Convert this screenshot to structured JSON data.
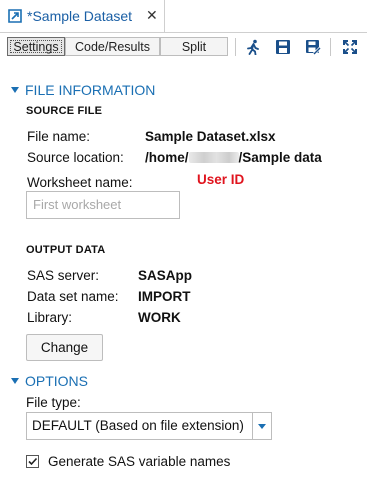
{
  "tab": {
    "title": "*Sample Dataset",
    "close": "✕"
  },
  "toolbar": {
    "segments": [
      "Settings",
      "Code/Results",
      "Split"
    ]
  },
  "file_information": {
    "header": "FILE INFORMATION",
    "source_file": {
      "subheader": "SOURCE FILE",
      "file_name_label": "File name:",
      "file_name_value": "Sample Dataset.xlsx",
      "source_location_label": "Source location:",
      "source_location_prefix": "/home/",
      "source_location_suffix": "/Sample data",
      "worksheet_label": "Worksheet name:",
      "worksheet_placeholder": "First worksheet",
      "annotation": "User ID"
    },
    "output_data": {
      "subheader": "OUTPUT DATA",
      "server_label": "SAS server:",
      "server_value": "SASApp",
      "dataset_label": "Data set name:",
      "dataset_value": "IMPORT",
      "library_label": "Library:",
      "library_value": "WORK",
      "change_button": "Change"
    }
  },
  "options": {
    "header": "OPTIONS",
    "file_type_label": "File type:",
    "file_type_value": "DEFAULT (Based on file extension)",
    "generate_names_label": "Generate SAS variable names",
    "generate_names_checked": true
  },
  "colors": {
    "accent": "#1a6fb3",
    "annotation": "#e0141e"
  }
}
